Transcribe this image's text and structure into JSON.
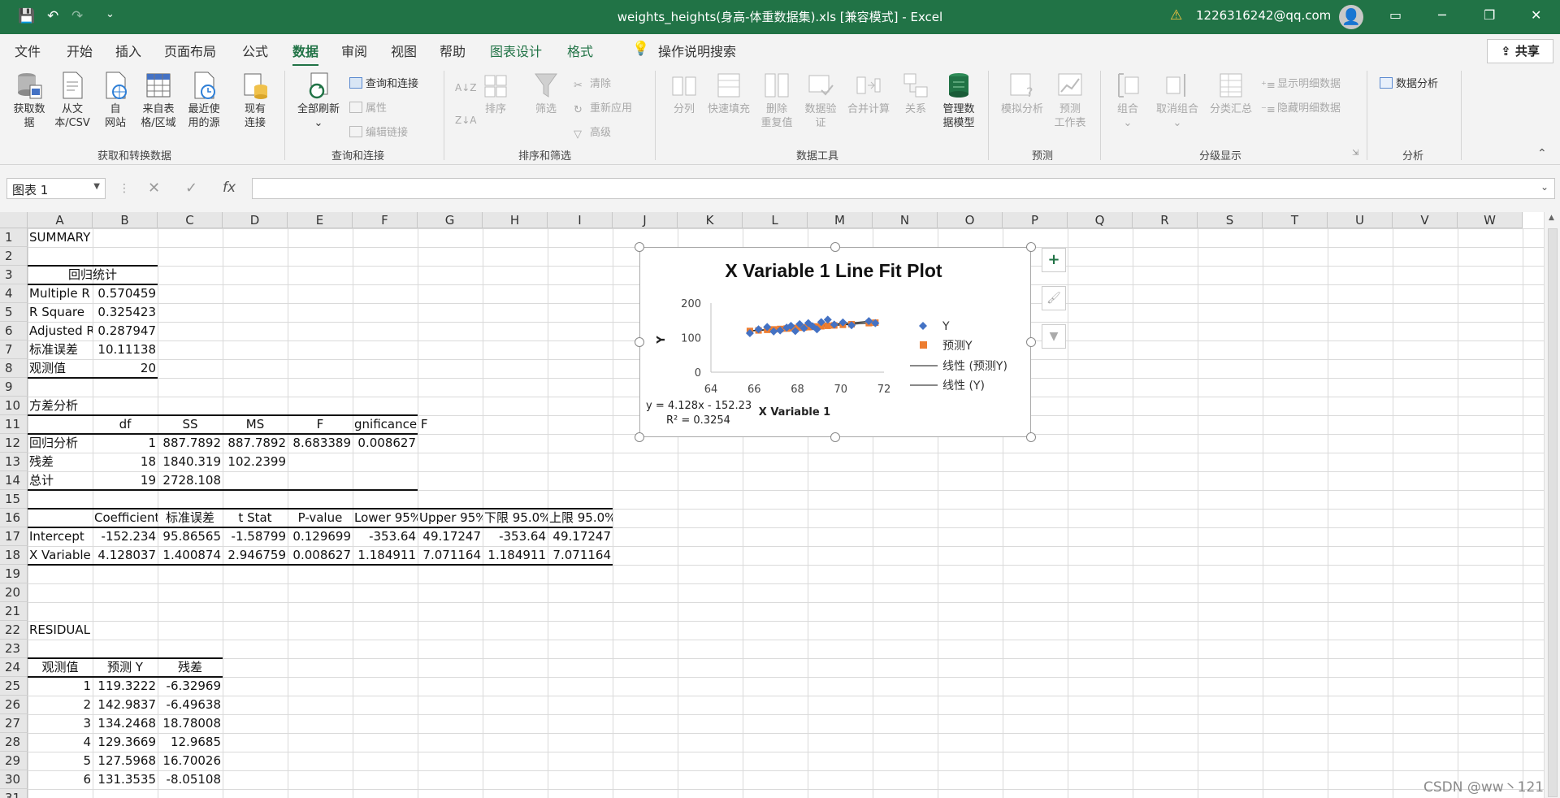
{
  "titlebar": {
    "title": "weights_heights(身高-体重数据集).xls  [兼容模式]  -  Excel",
    "account": "1226316242@qq.com",
    "undo_icon": "↶",
    "redo_icon": "↷"
  },
  "tabs": [
    "文件",
    "开始",
    "插入",
    "页面布局",
    "公式",
    "数据",
    "审阅",
    "视图",
    "帮助",
    "图表设计",
    "格式"
  ],
  "active_tab": "数据",
  "tell_me": "操作说明搜索",
  "share": "共享",
  "ribbon": {
    "get_data": {
      "label": "获取数\n据",
      "dropdown": true
    },
    "from_csv": "从文\n本/CSV",
    "from_web": "自\n网站",
    "from_table": "来自表\n格/区域",
    "recent_sources": "最近使\n用的源",
    "existing_conn": "现有\n连接",
    "group1": "获取和转换数据",
    "refresh_all": "全部刷新",
    "queries_conn": "查询和连接",
    "properties": "属性",
    "edit_links": "编辑链接",
    "group2": "查询和连接",
    "sort_asc_icon": "A↓Z",
    "sort": "排序",
    "filter": "筛选",
    "clear": "清除",
    "reapply": "重新应用",
    "advanced": "高级",
    "group3": "排序和筛选",
    "text_to_col": "分列",
    "flash_fill": "快速填充",
    "remove_dup": "删除\n重复值",
    "data_valid": "数据验\n证",
    "consolidate": "合并计算",
    "relations": "关系",
    "manage_model": "管理数\n据模型",
    "group4": "数据工具",
    "what_if": "模拟分析",
    "forecast": "预测\n工作表",
    "group5": "预测",
    "group_btn": "组合",
    "ungroup": "取消组合",
    "subtotal": "分类汇总",
    "show_detail": "显示明细数据",
    "hide_detail": "隐藏明细数据",
    "group6": "分级显示",
    "data_analysis": "数据分析",
    "group7": "分析"
  },
  "namebox": "图表 1",
  "formula_icons": {
    "cancel": "✕",
    "enter": "✓",
    "fx": "fx"
  },
  "columns": [
    "A",
    "B",
    "C",
    "D",
    "E",
    "F",
    "G",
    "H",
    "I",
    "J",
    "K",
    "L",
    "M",
    "N",
    "O",
    "P",
    "Q",
    "R",
    "S",
    "T",
    "U",
    "V",
    "W"
  ],
  "rows": [
    "1",
    "2",
    "3",
    "4",
    "5",
    "6",
    "7",
    "8",
    "9",
    "10",
    "11",
    "12",
    "13",
    "14",
    "15",
    "16",
    "17",
    "18",
    "19",
    "20",
    "21",
    "22",
    "23",
    "24",
    "25",
    "26",
    "27",
    "28",
    "29",
    "30",
    "31"
  ],
  "cells": [
    {
      "r": 1,
      "c": 0,
      "v": "SUMMARY OUTPUT"
    },
    {
      "r": 3,
      "c": 0,
      "v": "回归统计",
      "span": 2,
      "align": "ctr"
    },
    {
      "r": 4,
      "c": 0,
      "v": "Multiple R"
    },
    {
      "r": 4,
      "c": 1,
      "v": "0.570459",
      "align": "num"
    },
    {
      "r": 5,
      "c": 0,
      "v": "R Square"
    },
    {
      "r": 5,
      "c": 1,
      "v": "0.325423",
      "align": "num"
    },
    {
      "r": 6,
      "c": 0,
      "v": "Adjusted R"
    },
    {
      "r": 6,
      "c": 1,
      "v": "0.287947",
      "align": "num"
    },
    {
      "r": 7,
      "c": 0,
      "v": "标准误差"
    },
    {
      "r": 7,
      "c": 1,
      "v": "10.11138",
      "align": "num"
    },
    {
      "r": 8,
      "c": 0,
      "v": "观测值"
    },
    {
      "r": 8,
      "c": 1,
      "v": "20",
      "align": "num"
    },
    {
      "r": 10,
      "c": 0,
      "v": "方差分析"
    },
    {
      "r": 11,
      "c": 1,
      "v": "df",
      "align": "ctr"
    },
    {
      "r": 11,
      "c": 2,
      "v": "SS",
      "align": "ctr"
    },
    {
      "r": 11,
      "c": 3,
      "v": "MS",
      "align": "ctr"
    },
    {
      "r": 11,
      "c": 4,
      "v": "F",
      "align": "ctr"
    },
    {
      "r": 11,
      "c": 5,
      "v": "gnificance F",
      "align": "ctr",
      "overflow": true
    },
    {
      "r": 12,
      "c": 0,
      "v": "回归分析"
    },
    {
      "r": 12,
      "c": 1,
      "v": "1",
      "align": "num"
    },
    {
      "r": 12,
      "c": 2,
      "v": "887.7892",
      "align": "num"
    },
    {
      "r": 12,
      "c": 3,
      "v": "887.7892",
      "align": "num"
    },
    {
      "r": 12,
      "c": 4,
      "v": "8.683389",
      "align": "num"
    },
    {
      "r": 12,
      "c": 5,
      "v": "0.008627",
      "align": "num"
    },
    {
      "r": 13,
      "c": 0,
      "v": "残差"
    },
    {
      "r": 13,
      "c": 1,
      "v": "18",
      "align": "num"
    },
    {
      "r": 13,
      "c": 2,
      "v": "1840.319",
      "align": "num"
    },
    {
      "r": 13,
      "c": 3,
      "v": "102.2399",
      "align": "num"
    },
    {
      "r": 14,
      "c": 0,
      "v": "总计"
    },
    {
      "r": 14,
      "c": 1,
      "v": "19",
      "align": "num"
    },
    {
      "r": 14,
      "c": 2,
      "v": "2728.108",
      "align": "num"
    },
    {
      "r": 16,
      "c": 1,
      "v": "Coefficients",
      "align": "ctr"
    },
    {
      "r": 16,
      "c": 2,
      "v": "标准误差",
      "align": "ctr"
    },
    {
      "r": 16,
      "c": 3,
      "v": "t Stat",
      "align": "ctr"
    },
    {
      "r": 16,
      "c": 4,
      "v": "P-value",
      "align": "ctr"
    },
    {
      "r": 16,
      "c": 5,
      "v": "Lower 95%",
      "align": "ctr"
    },
    {
      "r": 16,
      "c": 6,
      "v": "Upper 95%",
      "align": "ctr"
    },
    {
      "r": 16,
      "c": 7,
      "v": "下限 95.0%",
      "align": "ctr"
    },
    {
      "r": 16,
      "c": 8,
      "v": "上限 95.0%",
      "align": "ctr"
    },
    {
      "r": 17,
      "c": 0,
      "v": "Intercept"
    },
    {
      "r": 17,
      "c": 1,
      "v": "-152.234",
      "align": "num"
    },
    {
      "r": 17,
      "c": 2,
      "v": "95.86565",
      "align": "num"
    },
    {
      "r": 17,
      "c": 3,
      "v": "-1.58799",
      "align": "num"
    },
    {
      "r": 17,
      "c": 4,
      "v": "0.129699",
      "align": "num"
    },
    {
      "r": 17,
      "c": 5,
      "v": "-353.64",
      "align": "num"
    },
    {
      "r": 17,
      "c": 6,
      "v": "49.17247",
      "align": "num"
    },
    {
      "r": 17,
      "c": 7,
      "v": "-353.64",
      "align": "num"
    },
    {
      "r": 17,
      "c": 8,
      "v": "49.17247",
      "align": "num"
    },
    {
      "r": 18,
      "c": 0,
      "v": "X Variable"
    },
    {
      "r": 18,
      "c": 1,
      "v": "4.128037",
      "align": "num"
    },
    {
      "r": 18,
      "c": 2,
      "v": "1.400874",
      "align": "num"
    },
    {
      "r": 18,
      "c": 3,
      "v": "2.946759",
      "align": "num"
    },
    {
      "r": 18,
      "c": 4,
      "v": "0.008627",
      "align": "num"
    },
    {
      "r": 18,
      "c": 5,
      "v": "1.184911",
      "align": "num"
    },
    {
      "r": 18,
      "c": 6,
      "v": "7.071164",
      "align": "num"
    },
    {
      "r": 18,
      "c": 7,
      "v": "1.184911",
      "align": "num"
    },
    {
      "r": 18,
      "c": 8,
      "v": "7.071164",
      "align": "num"
    },
    {
      "r": 22,
      "c": 0,
      "v": "RESIDUAL OUTPUT"
    },
    {
      "r": 24,
      "c": 0,
      "v": "观测值",
      "align": "ctr"
    },
    {
      "r": 24,
      "c": 1,
      "v": "预测 Y",
      "align": "ctr"
    },
    {
      "r": 24,
      "c": 2,
      "v": "残差",
      "align": "ctr"
    },
    {
      "r": 25,
      "c": 0,
      "v": "1",
      "align": "num"
    },
    {
      "r": 25,
      "c": 1,
      "v": "119.3222",
      "align": "num"
    },
    {
      "r": 25,
      "c": 2,
      "v": "-6.32969",
      "align": "num"
    },
    {
      "r": 26,
      "c": 0,
      "v": "2",
      "align": "num"
    },
    {
      "r": 26,
      "c": 1,
      "v": "142.9837",
      "align": "num"
    },
    {
      "r": 26,
      "c": 2,
      "v": "-6.49638",
      "align": "num"
    },
    {
      "r": 27,
      "c": 0,
      "v": "3",
      "align": "num"
    },
    {
      "r": 27,
      "c": 1,
      "v": "134.2468",
      "align": "num"
    },
    {
      "r": 27,
      "c": 2,
      "v": "18.78008",
      "align": "num"
    },
    {
      "r": 28,
      "c": 0,
      "v": "4",
      "align": "num"
    },
    {
      "r": 28,
      "c": 1,
      "v": "129.3669",
      "align": "num"
    },
    {
      "r": 28,
      "c": 2,
      "v": "12.9685",
      "align": "num"
    },
    {
      "r": 29,
      "c": 0,
      "v": "5",
      "align": "num"
    },
    {
      "r": 29,
      "c": 1,
      "v": "127.5968",
      "align": "num"
    },
    {
      "r": 29,
      "c": 2,
      "v": "16.70026",
      "align": "num"
    },
    {
      "r": 30,
      "c": 0,
      "v": "6",
      "align": "num"
    },
    {
      "r": 30,
      "c": 1,
      "v": "131.3535",
      "align": "num"
    },
    {
      "r": 30,
      "c": 2,
      "v": "-8.05108",
      "align": "num"
    }
  ],
  "borders": [
    {
      "r": 3,
      "c0": 0,
      "c1": 2,
      "pos": "top"
    },
    {
      "r": 3,
      "c0": 0,
      "c1": 2,
      "pos": "bottom"
    },
    {
      "r": 8,
      "c0": 0,
      "c1": 2,
      "pos": "bottom"
    },
    {
      "r": 11,
      "c0": 0,
      "c1": 6,
      "pos": "top"
    },
    {
      "r": 11,
      "c0": 0,
      "c1": 6,
      "pos": "bottom"
    },
    {
      "r": 14,
      "c0": 0,
      "c1": 6,
      "pos": "bottom"
    },
    {
      "r": 16,
      "c0": 0,
      "c1": 9,
      "pos": "top"
    },
    {
      "r": 16,
      "c0": 0,
      "c1": 9,
      "pos": "bottom"
    },
    {
      "r": 18,
      "c0": 0,
      "c1": 9,
      "pos": "bottom"
    },
    {
      "r": 24,
      "c0": 0,
      "c1": 3,
      "pos": "top"
    },
    {
      "r": 24,
      "c0": 0,
      "c1": 3,
      "pos": "bottom"
    }
  ],
  "chart_side_icons": {
    "add": "+",
    "style": "🖌",
    "filter": "▼"
  },
  "chart_data": {
    "type": "scatter",
    "title": "X Variable 1 Line Fit  Plot",
    "xlabel": "X Variable 1",
    "ylabel": "Y",
    "xlim": [
      64,
      72
    ],
    "ylim": [
      0,
      200
    ],
    "xticks": [
      "64",
      "66",
      "68",
      "70",
      "72"
    ],
    "yticks": [
      "0",
      "100",
      "200"
    ],
    "series": [
      {
        "name": "Y",
        "marker": "diamond",
        "color": "#4472c4",
        "x": [
          65.8,
          66.2,
          66.6,
          66.9,
          67.2,
          67.5,
          67.7,
          67.9,
          68.1,
          68.3,
          68.5,
          68.7,
          68.9,
          69.1,
          69.4,
          69.7,
          70.1,
          70.5,
          71.3,
          71.6
        ],
        "y": [
          113,
          124,
          131,
          118,
          121,
          129,
          134,
          119,
          139,
          127,
          142,
          133,
          124,
          145,
          152,
          138,
          144,
          136,
          148,
          142
        ]
      },
      {
        "name": "预测Y",
        "marker": "square",
        "color": "#ed7d31",
        "x": [
          65.8,
          66.2,
          66.6,
          66.9,
          67.2,
          67.5,
          67.7,
          67.9,
          68.1,
          68.3,
          68.5,
          68.7,
          68.9,
          69.1,
          69.4,
          69.7,
          70.1,
          70.5,
          71.3,
          71.6
        ],
        "y": [
          119.3,
          121,
          122.7,
          123.9,
          125.2,
          126.4,
          127.2,
          128.1,
          128.9,
          129.7,
          130.5,
          131.4,
          132.2,
          133,
          134.3,
          135.5,
          137.2,
          138.8,
          142.1,
          143.3
        ]
      }
    ],
    "trendline_legend": [
      "线性 (预测Y)",
      "线性 (Y)"
    ],
    "equation": "y = 4.128x - 152.23",
    "r2": "R² = 0.3254"
  },
  "watermark": "CSDN @ww丶121"
}
